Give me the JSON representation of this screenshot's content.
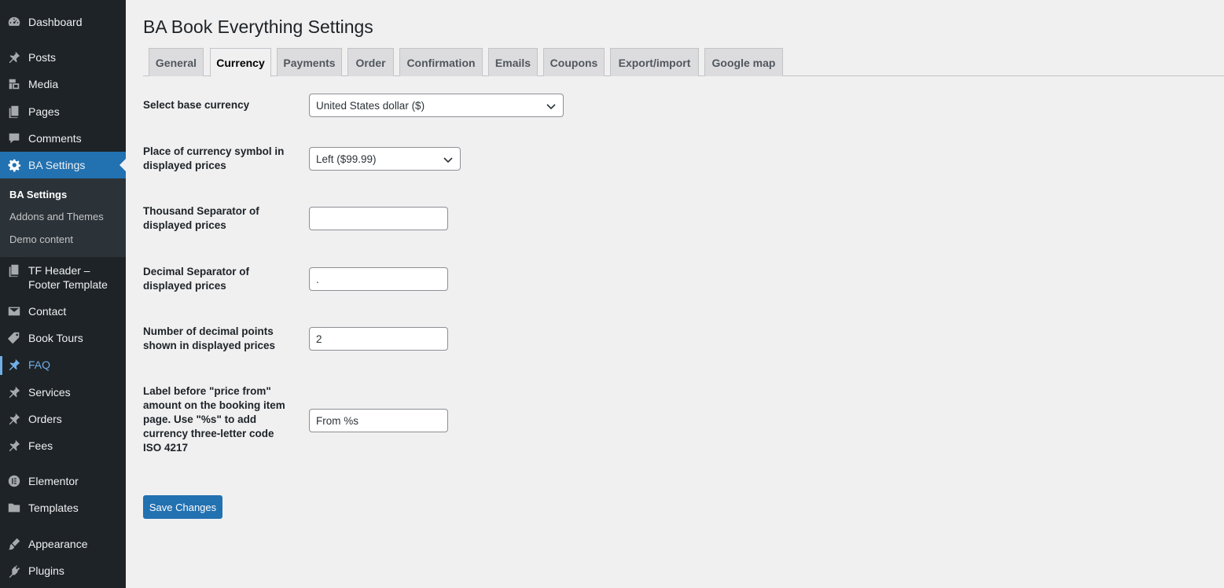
{
  "sidebar": {
    "items": [
      {
        "label": "Dashboard",
        "icon": "dashboard-icon"
      },
      {
        "label": "Posts",
        "icon": "pin-icon"
      },
      {
        "label": "Media",
        "icon": "media-icon"
      },
      {
        "label": "Pages",
        "icon": "pages-icon"
      },
      {
        "label": "Comments",
        "icon": "comment-icon"
      },
      {
        "label": "BA Settings",
        "icon": "gear-icon"
      },
      {
        "label": "TF Header – Footer Template",
        "icon": "pages-icon"
      },
      {
        "label": "Contact",
        "icon": "mail-icon"
      },
      {
        "label": "Book Tours",
        "icon": "tag-icon"
      },
      {
        "label": "FAQ",
        "icon": "pin-icon"
      },
      {
        "label": "Services",
        "icon": "pin-icon"
      },
      {
        "label": "Orders",
        "icon": "pin-icon"
      },
      {
        "label": "Fees",
        "icon": "pin-icon"
      },
      {
        "label": "Elementor",
        "icon": "elementor-icon"
      },
      {
        "label": "Templates",
        "icon": "folder-icon"
      },
      {
        "label": "Appearance",
        "icon": "brush-icon"
      },
      {
        "label": "Plugins",
        "icon": "plugin-icon"
      }
    ],
    "submenu": [
      {
        "label": "BA Settings"
      },
      {
        "label": "Addons and Themes"
      },
      {
        "label": "Demo content"
      }
    ]
  },
  "page": {
    "title": "BA Book Everything Settings"
  },
  "tabs": [
    {
      "label": "General"
    },
    {
      "label": "Currency"
    },
    {
      "label": "Payments"
    },
    {
      "label": "Order"
    },
    {
      "label": "Confirmation"
    },
    {
      "label": "Emails"
    },
    {
      "label": "Coupons"
    },
    {
      "label": "Export/import"
    },
    {
      "label": "Google map"
    }
  ],
  "fields": {
    "base_currency": {
      "label": "Select base currency",
      "value": "United States dollar ($)"
    },
    "symbol_place": {
      "label": "Place of currency symbol in displayed prices",
      "value": "Left ($99.99)"
    },
    "thousand_sep": {
      "label": "Thousand Separator of displayed prices",
      "value": ""
    },
    "decimal_sep": {
      "label": "Decimal Separator of displayed prices",
      "value": "."
    },
    "decimal_points": {
      "label": "Number of decimal points shown in displayed prices",
      "value": "2"
    },
    "price_from_label": {
      "label": "Label before \"price from\" amount on the booking item page. Use \"%s\" to add currency three-letter code ISO 4217",
      "value": "From %s"
    }
  },
  "save_button": {
    "label": "Save Changes"
  },
  "colors": {
    "sidebar_bg": "#1d2327",
    "accent": "#2271b1",
    "submenu_bg": "#2c3338",
    "faq_highlight": "#72aee6"
  }
}
